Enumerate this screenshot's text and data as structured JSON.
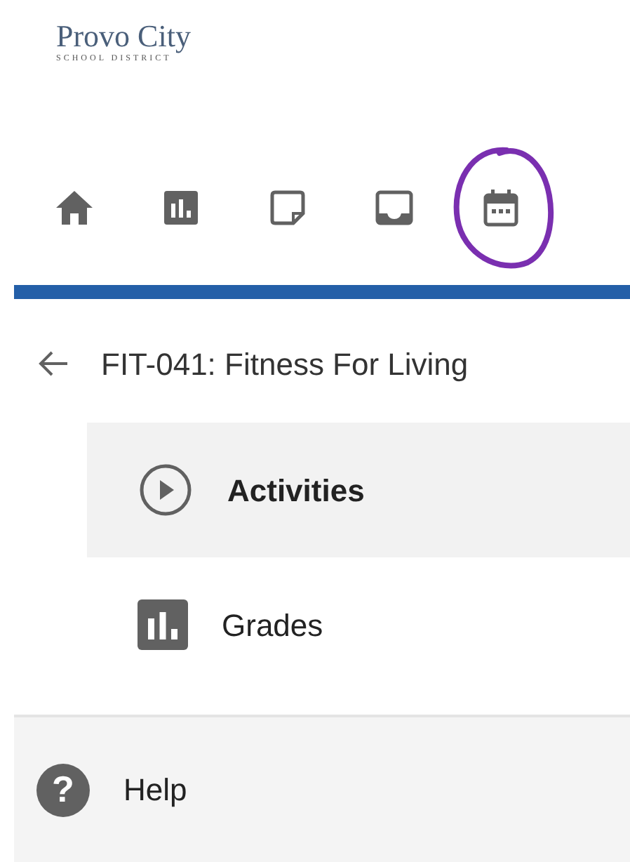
{
  "logo": {
    "name": "Provo City",
    "subtitle": "SCHOOL DISTRICT"
  },
  "nav_icons": [
    {
      "kind": "home",
      "circled": false
    },
    {
      "kind": "chart",
      "circled": false
    },
    {
      "kind": "note",
      "circled": false
    },
    {
      "kind": "inbox",
      "circled": false
    },
    {
      "kind": "calendar",
      "circled": true
    }
  ],
  "course": {
    "title": "FIT-041: Fitness For Living"
  },
  "menu": [
    {
      "kind": "play",
      "label": "Activities",
      "selected": true
    },
    {
      "kind": "chart",
      "label": "Grades",
      "selected": false
    }
  ],
  "help": {
    "icon": "?",
    "label": "Help"
  }
}
